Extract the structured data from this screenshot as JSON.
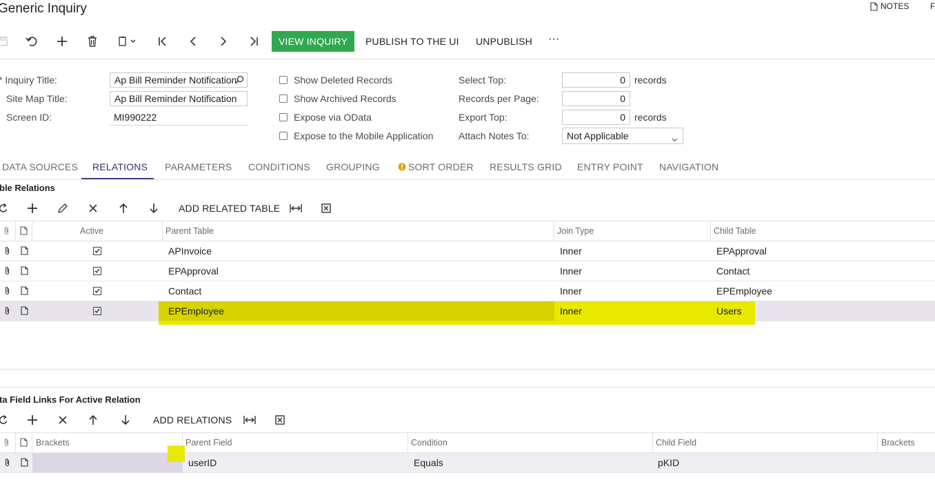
{
  "page": {
    "title": "Generic Inquiry"
  },
  "top_right": {
    "notes_label": "NOTES",
    "extra_label": "F"
  },
  "toolbar": {
    "view_inquiry": "VIEW INQUIRY",
    "publish": "PUBLISH TO THE UI",
    "unpublish": "UNPUBLISH",
    "more": "···"
  },
  "form": {
    "inquiry_title_label": "* Inquiry Title:",
    "inquiry_title_value": "Ap Bill Reminder Notification",
    "site_map_title_label": "Site Map Title:",
    "site_map_title_value": "Ap Bill Reminder Notification",
    "screen_id_label": "Screen ID:",
    "screen_id_value": "MI990222",
    "show_deleted": "Show Deleted Records",
    "show_archived": "Show Archived Records",
    "expose_odata": "Expose via OData",
    "expose_mobile": "Expose to the Mobile Application",
    "select_top_label": "Select Top:",
    "select_top_value": "0",
    "select_top_unit": "records",
    "records_per_page_label": "Records per Page:",
    "records_per_page_value": "0",
    "export_top_label": "Export Top:",
    "export_top_value": "0",
    "export_top_unit": "records",
    "attach_notes_label": "Attach Notes To:",
    "attach_notes_value": "Not Applicable"
  },
  "tabs": [
    {
      "label": "DATA SOURCES"
    },
    {
      "label": "RELATIONS"
    },
    {
      "label": "PARAMETERS"
    },
    {
      "label": "CONDITIONS"
    },
    {
      "label": "GROUPING"
    },
    {
      "label": "SORT ORDER"
    },
    {
      "label": "RESULTS GRID"
    },
    {
      "label": "ENTRY POINT"
    },
    {
      "label": "NAVIGATION"
    }
  ],
  "relations": {
    "section_title": "ble Relations",
    "add_related_table": "ADD RELATED TABLE",
    "columns": {
      "active": "Active",
      "parent": "Parent Table",
      "join": "Join Type",
      "child": "Child Table"
    },
    "rows": [
      {
        "parent": "APInvoice",
        "join": "Inner",
        "child": "EPApproval"
      },
      {
        "parent": "EPApproval",
        "join": "Inner",
        "child": "Contact"
      },
      {
        "parent": "Contact",
        "join": "Inner",
        "child": "EPEmployee"
      },
      {
        "parent": "EPEmployee",
        "join": "Inner",
        "child": "Users"
      }
    ]
  },
  "links": {
    "section_title": "ta Field Links For Active Relation",
    "add_relations": "ADD RELATIONS",
    "columns": {
      "brackets_open": "Brackets",
      "parent_field": "Parent Field",
      "condition": "Condition",
      "child_field": "Child Field",
      "brackets_close": "Brackets"
    },
    "rows": [
      {
        "brackets_open": "",
        "parent_field": "userID",
        "condition": "Equals",
        "child_field": "pKID",
        "brackets_close": ""
      }
    ]
  },
  "colors": {
    "accent_green": "#2fa84f",
    "tab_active": "#4b3f8a",
    "highlight": "#e9e900",
    "selected_row": "#e8e4ee"
  }
}
